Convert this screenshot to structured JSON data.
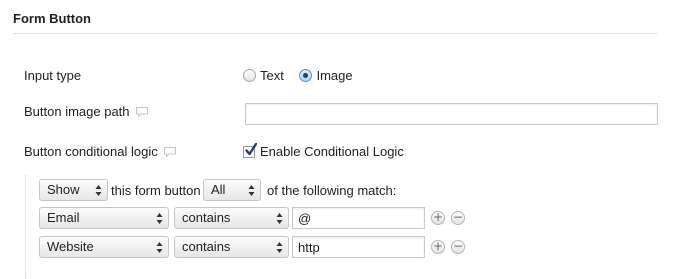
{
  "section": {
    "title": "Form Button"
  },
  "input_type": {
    "label": "Input type",
    "options": [
      {
        "label": "Text",
        "selected": false
      },
      {
        "label": "Image",
        "selected": true
      }
    ]
  },
  "image_path": {
    "label": "Button image path",
    "value": "",
    "placeholder": ""
  },
  "conditional": {
    "label": "Button conditional logic",
    "checkbox_label": "Enable Conditional Logic",
    "enabled": true
  },
  "logic": {
    "action_value": "Show",
    "middle_text": "this form button",
    "match_value": "All",
    "tail_text": "of the following match:",
    "rules": [
      {
        "field": "Email",
        "operator": "contains",
        "value": "@"
      },
      {
        "field": "Website",
        "operator": "contains",
        "value": "http"
      }
    ],
    "add_symbol": "+",
    "remove_symbol": "−"
  },
  "icons": {
    "tooltip": "speech-bubble-icon",
    "select_arrows": "updown-arrows-icon"
  },
  "colors": {
    "accent": "#1e3f76",
    "divider": "#dfdfdf"
  }
}
